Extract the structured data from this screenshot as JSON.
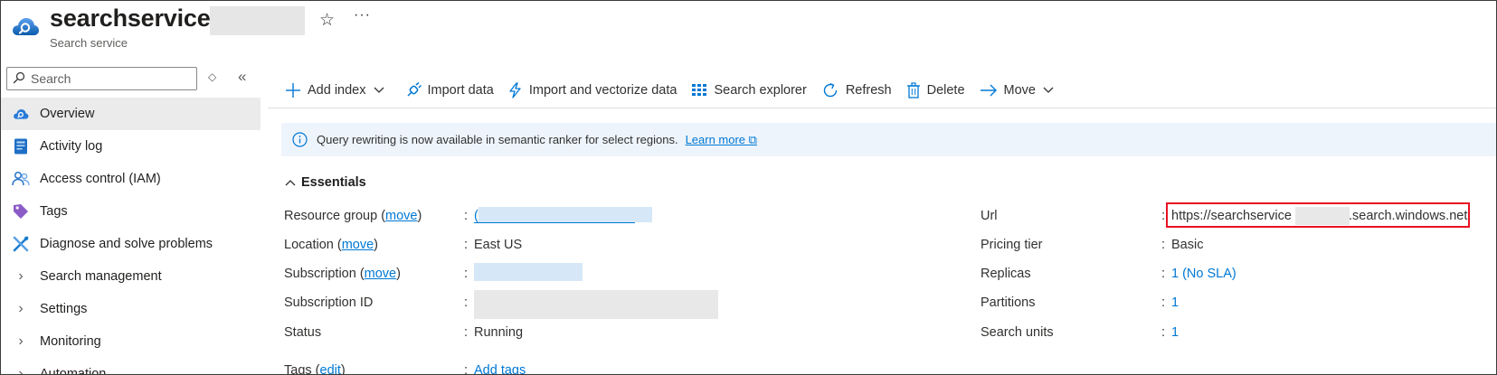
{
  "header": {
    "title": "searchservice-",
    "subtitle": "Search service",
    "star_glyph": "☆",
    "more_glyph": "···"
  },
  "sidebar": {
    "search_placeholder": "Search",
    "items": [
      {
        "label": "Overview",
        "icon": "cloud-search-icon",
        "selected": true
      },
      {
        "label": "Activity log",
        "icon": "activity-log-icon"
      },
      {
        "label": "Access control (IAM)",
        "icon": "people-icon"
      },
      {
        "label": "Tags",
        "icon": "tag-icon"
      },
      {
        "label": "Diagnose and solve problems",
        "icon": "wrench-icon"
      },
      {
        "label": "Search management",
        "icon": "chevron-right-icon"
      },
      {
        "label": "Settings",
        "icon": "chevron-right-icon"
      },
      {
        "label": "Monitoring",
        "icon": "chevron-right-icon"
      },
      {
        "label": "Automation",
        "icon": "chevron-right-icon"
      }
    ]
  },
  "toolbar": {
    "add_index": "Add index",
    "import_data": "Import data",
    "import_vectorize": "Import and vectorize data",
    "search_explorer": "Search explorer",
    "refresh": "Refresh",
    "delete": "Delete",
    "move": "Move"
  },
  "banner": {
    "text": "Query rewriting is now available in semantic ranker for select regions.",
    "link": "Learn more"
  },
  "essentials": {
    "heading": "Essentials",
    "left": {
      "resource_group_label": "Resource group",
      "location_label": "Location",
      "subscription_label": "Subscription",
      "subscription_id_label": "Subscription ID",
      "status_label": "Status",
      "tags_label": "Tags",
      "move_link": "move",
      "edit_link": "edit",
      "resource_group_value": "(",
      "location_value": "East US",
      "status_value": "Running",
      "tags_value": "Add tags"
    },
    "right": {
      "url_label": "Url",
      "pricing_label": "Pricing tier",
      "replicas_label": "Replicas",
      "partitions_label": "Partitions",
      "search_units_label": "Search units",
      "url_prefix": "https://searchservice",
      "url_suffix": ".search.windows.net",
      "pricing_value": "Basic",
      "replicas_value": "1 (No SLA)",
      "partitions_value": "1",
      "search_units_value": "1"
    }
  },
  "colors": {
    "accent": "#0078d4",
    "highlight_box": "#e81123",
    "banner_bg": "#eef4fb",
    "selected_nav_bg": "#ebebeb"
  }
}
